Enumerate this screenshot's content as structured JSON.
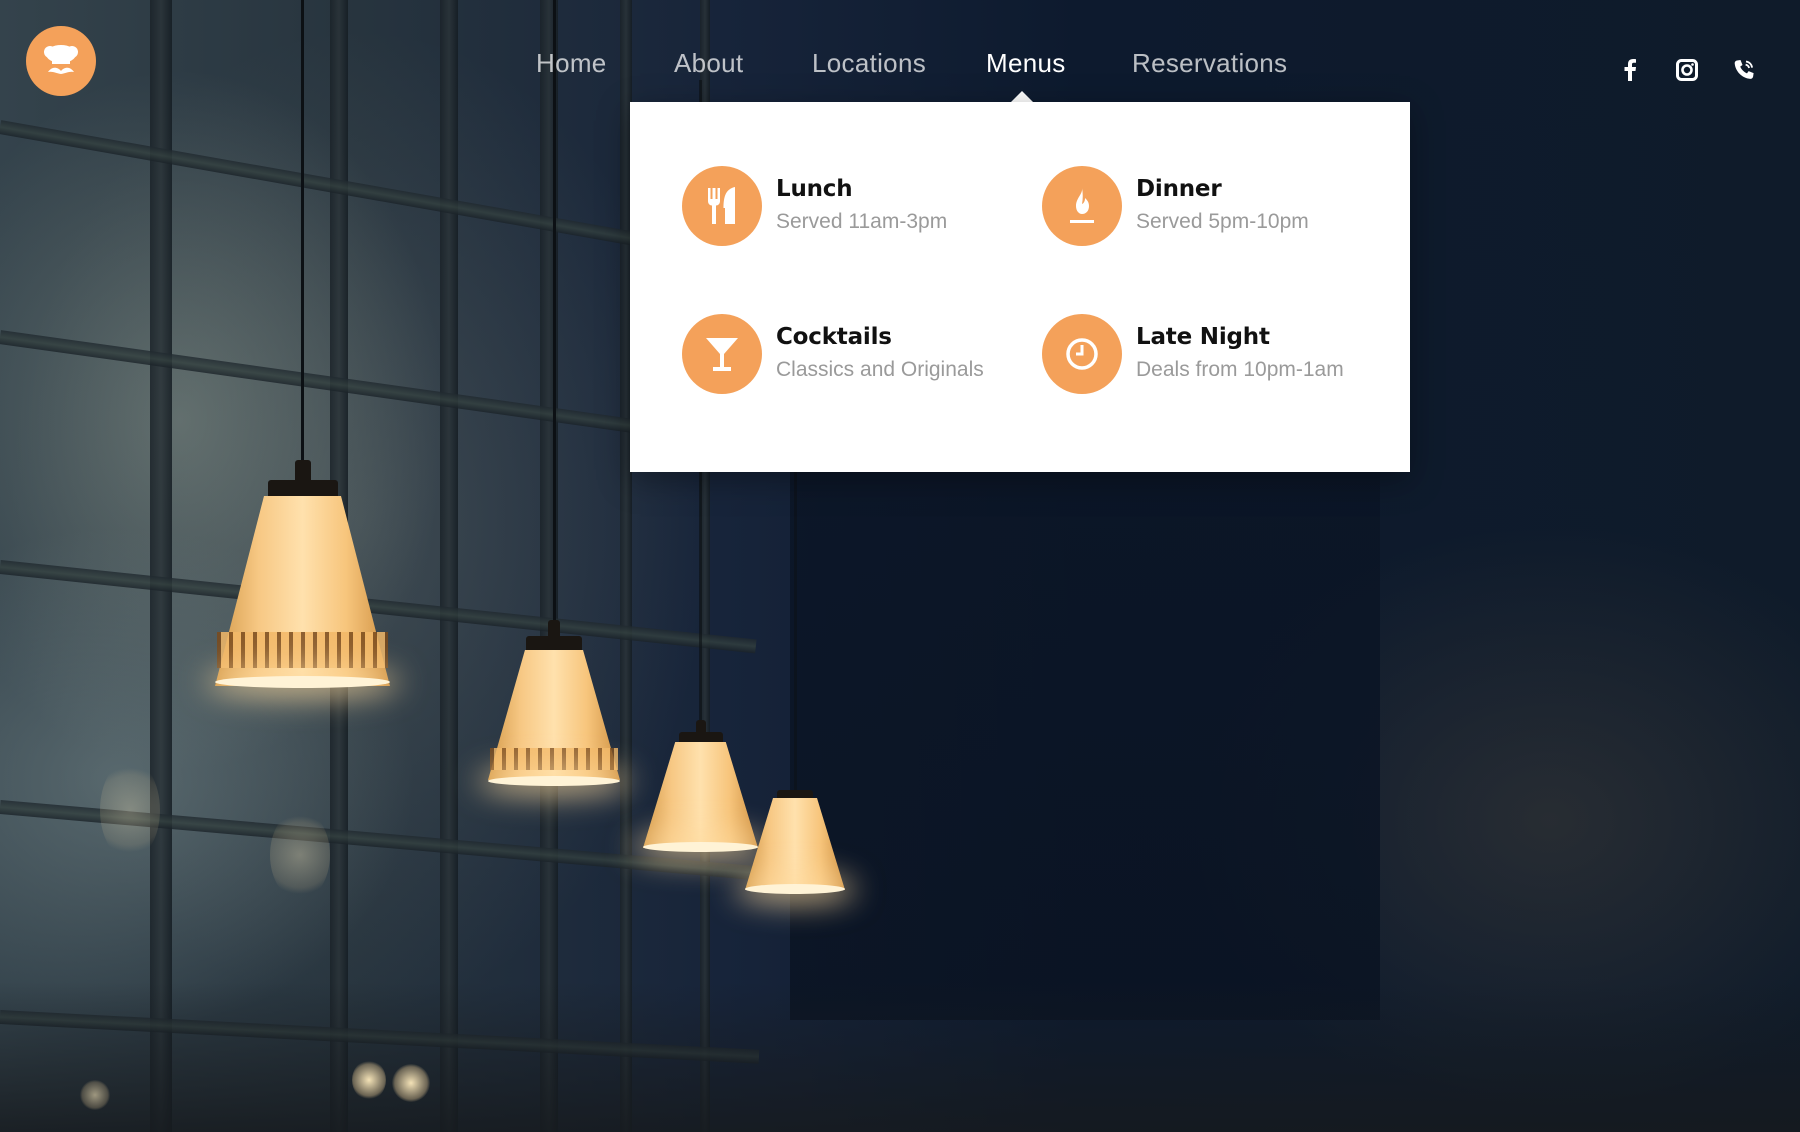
{
  "brand": {
    "logo_icon": "chef-mustache-icon",
    "accent_color": "#f4a15a"
  },
  "nav": {
    "items": [
      {
        "label": "Home"
      },
      {
        "label": "About"
      },
      {
        "label": "Locations"
      },
      {
        "label": "Menus"
      },
      {
        "label": "Reservations"
      }
    ],
    "active": "Menus"
  },
  "social": [
    {
      "icon": "facebook-icon"
    },
    {
      "icon": "instagram-icon"
    },
    {
      "icon": "phone-icon"
    }
  ],
  "menus_dropdown": {
    "items": [
      {
        "title": "Lunch",
        "subtitle": "Served 11am-3pm",
        "icon": "fork-knife-icon"
      },
      {
        "title": "Dinner",
        "subtitle": "Served 5pm-10pm",
        "icon": "flame-icon"
      },
      {
        "title": "Cocktails",
        "subtitle": "Classics and Originals",
        "icon": "cocktail-glass-icon"
      },
      {
        "title": "Late Night",
        "subtitle": "Deals from 10pm-1am",
        "icon": "clock-icon"
      }
    ]
  }
}
